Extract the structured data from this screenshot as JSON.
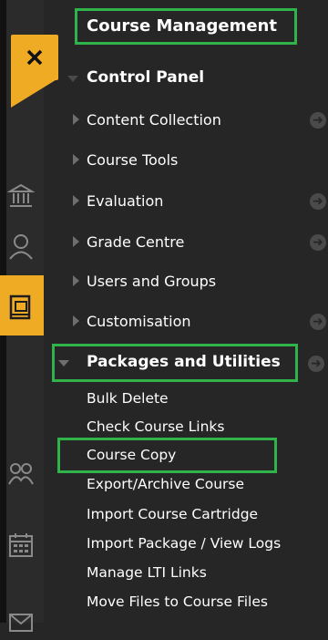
{
  "header": {
    "title": "Course Management"
  },
  "control_panel": {
    "label": "Control Panel"
  },
  "menu": [
    {
      "label": "Content Collection",
      "has_arrow": true
    },
    {
      "label": "Course Tools",
      "has_arrow": false
    },
    {
      "label": "Evaluation",
      "has_arrow": true
    },
    {
      "label": "Grade Centre",
      "has_arrow": true
    },
    {
      "label": "Users and Groups",
      "has_arrow": false
    },
    {
      "label": "Customisation",
      "has_arrow": true
    }
  ],
  "packages": {
    "label": "Packages and Utilities",
    "items": [
      "Bulk Delete",
      "Check Course Links",
      "Course Copy",
      "Export/Archive Course",
      "Import Course Cartridge",
      "Import Package / View Logs",
      "Manage LTI Links",
      "Move Files to Course Files"
    ]
  },
  "colors": {
    "accent": "#f0ab25",
    "highlight": "#2fb34a",
    "background": "#262626"
  },
  "icons": [
    "close-icon",
    "institution-icon",
    "profile-icon",
    "globe-icon",
    "courses-icon",
    "organizations-icon",
    "calendar-icon",
    "messages-icon"
  ]
}
